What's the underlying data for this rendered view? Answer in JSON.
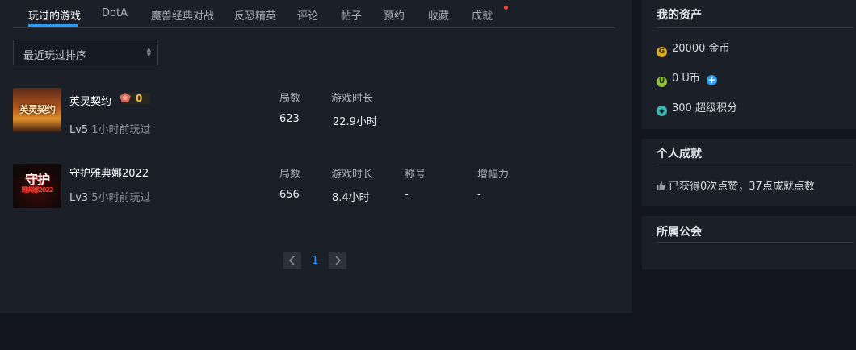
{
  "tabs": [
    "玩过的游戏",
    "DotA",
    "魔兽经典对战",
    "反恐精英",
    "评论",
    "帖子",
    "预约",
    "收藏",
    "成就"
  ],
  "sort": {
    "label": "最近玩过排序"
  },
  "games": [
    {
      "name": "英灵契约",
      "badge_value": "0",
      "level": "Lv5",
      "last_played": "1小时前玩过",
      "cover_text": "英灵契约",
      "stats": [
        {
          "label": "局数",
          "value": "623"
        },
        {
          "label": "游戏时长",
          "value": "22.9小时"
        }
      ]
    },
    {
      "name": "守护雅典娜2022",
      "level": "Lv3",
      "last_played": "5小时前玩过",
      "cover_text_top": "守护",
      "cover_text_bottom": "雅典娜2022",
      "stats": [
        {
          "label": "局数",
          "value": "656"
        },
        {
          "label": "游戏时长",
          "value": "8.4小时"
        },
        {
          "label": "称号",
          "value": "-"
        },
        {
          "label": "增幅力",
          "value": "-"
        }
      ]
    }
  ],
  "pagination": {
    "current": "1"
  },
  "assets": {
    "title": "我的资产",
    "items": [
      {
        "icon": "G",
        "text": "20000 金币",
        "color": "#d9a92a"
      },
      {
        "icon": "U",
        "text": "0 U币",
        "color": "#8fc23a"
      },
      {
        "icon": "◆",
        "text": "300 超级积分",
        "color": "#3fb6b0"
      }
    ]
  },
  "achievements": {
    "title": "个人成就",
    "text": "已获得0次点赞，37点成就点数"
  },
  "guild": {
    "title": "所属公会"
  },
  "colors": {
    "accent": "#2d9bf0",
    "background": "#1b1f28",
    "page_bg": "#13161e"
  }
}
